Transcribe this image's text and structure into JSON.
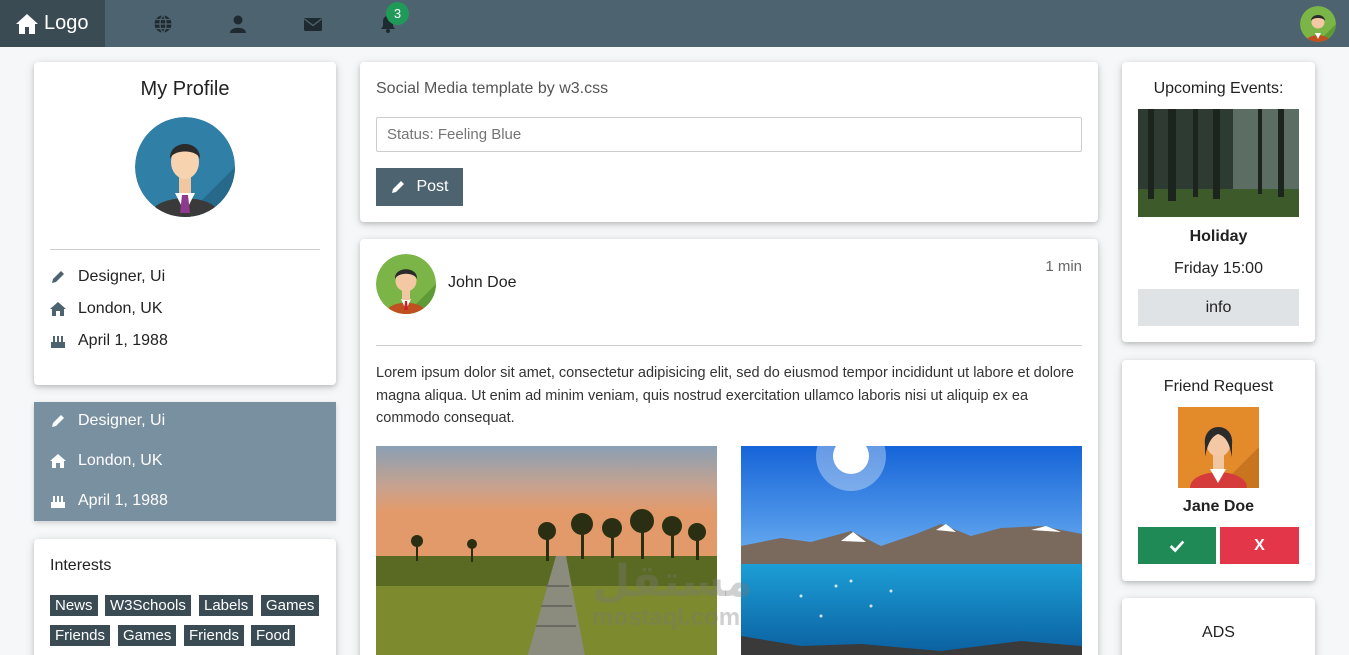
{
  "topbar": {
    "logo_label": "Logo",
    "notification_count": "3",
    "nav_icons": [
      "globe-icon",
      "user-icon",
      "envelope-icon",
      "bell-icon"
    ],
    "colors": {
      "bar": "#4d636f",
      "logo_bg": "#3a4b54",
      "badge": "#209a59"
    }
  },
  "profile": {
    "title": "My Profile",
    "job": "Designer, Ui",
    "location": "London, UK",
    "birthday": "April 1, 1988"
  },
  "accordion": {
    "job": "Designer, Ui",
    "location": "London, UK",
    "birthday": "April 1, 1988"
  },
  "interests": {
    "title": "Interests",
    "tags": [
      "News",
      "W3Schools",
      "Labels",
      "Games",
      "Friends",
      "Games",
      "Friends",
      "Food"
    ]
  },
  "status": {
    "title": "Social Media template by w3.css",
    "placeholder": "Status: Feeling Blue",
    "post_label": "Post"
  },
  "post": {
    "author": "John Doe",
    "time": "1 min",
    "text": "Lorem ipsum dolor sit amet, consectetur adipisicing elit, sed do eiusmod tempor incididunt ut labore et dolore magna aliqua. Ut enim ad minim veniam, quis nostrud exercitation ullamco laboris nisi ut aliquip ex ea commodo consequat."
  },
  "events": {
    "title": "Upcoming Events:",
    "name": "Holiday",
    "when": "Friday 15:00",
    "info_label": "info"
  },
  "friend_request": {
    "title": "Friend Request",
    "name": "Jane Doe",
    "decline_label": "X"
  },
  "ads": {
    "title": "ADS"
  },
  "watermark": {
    "arabic": "مستقل",
    "latin": "mostaql.com"
  }
}
